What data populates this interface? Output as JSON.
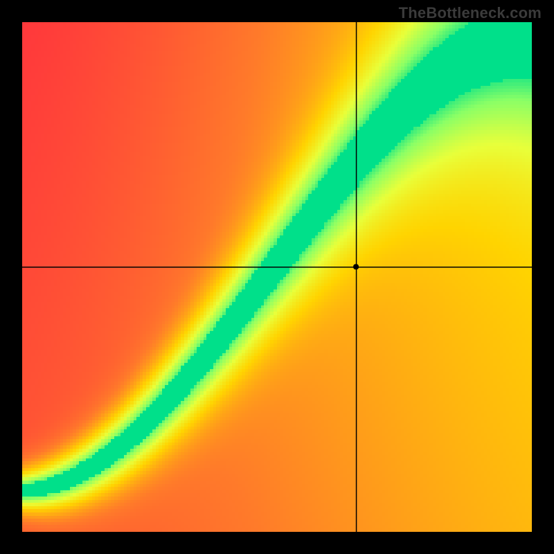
{
  "watermark": "TheBottleneck.com",
  "chart_data": {
    "type": "heatmap",
    "title": "",
    "xlabel": "",
    "ylabel": "",
    "x_range": [
      0,
      1
    ],
    "y_range": [
      0,
      1
    ],
    "crosshair": {
      "x": 0.655,
      "y": 0.52
    },
    "marker": {
      "x": 0.655,
      "y": 0.52,
      "radius": 4
    },
    "optimal_curve_description": "Green band runs roughly along y ≈ x^1.2 with slight S-curve; width narrows at low end and widens toward upper-right.",
    "color_legend": {
      "0.0": "#ff2a3f",
      "0.25": "#ff7a2a",
      "0.5": "#ffd400",
      "0.75": "#d6ff3a",
      "1.0": "#00e08a"
    },
    "grid_resolution": 160
  }
}
